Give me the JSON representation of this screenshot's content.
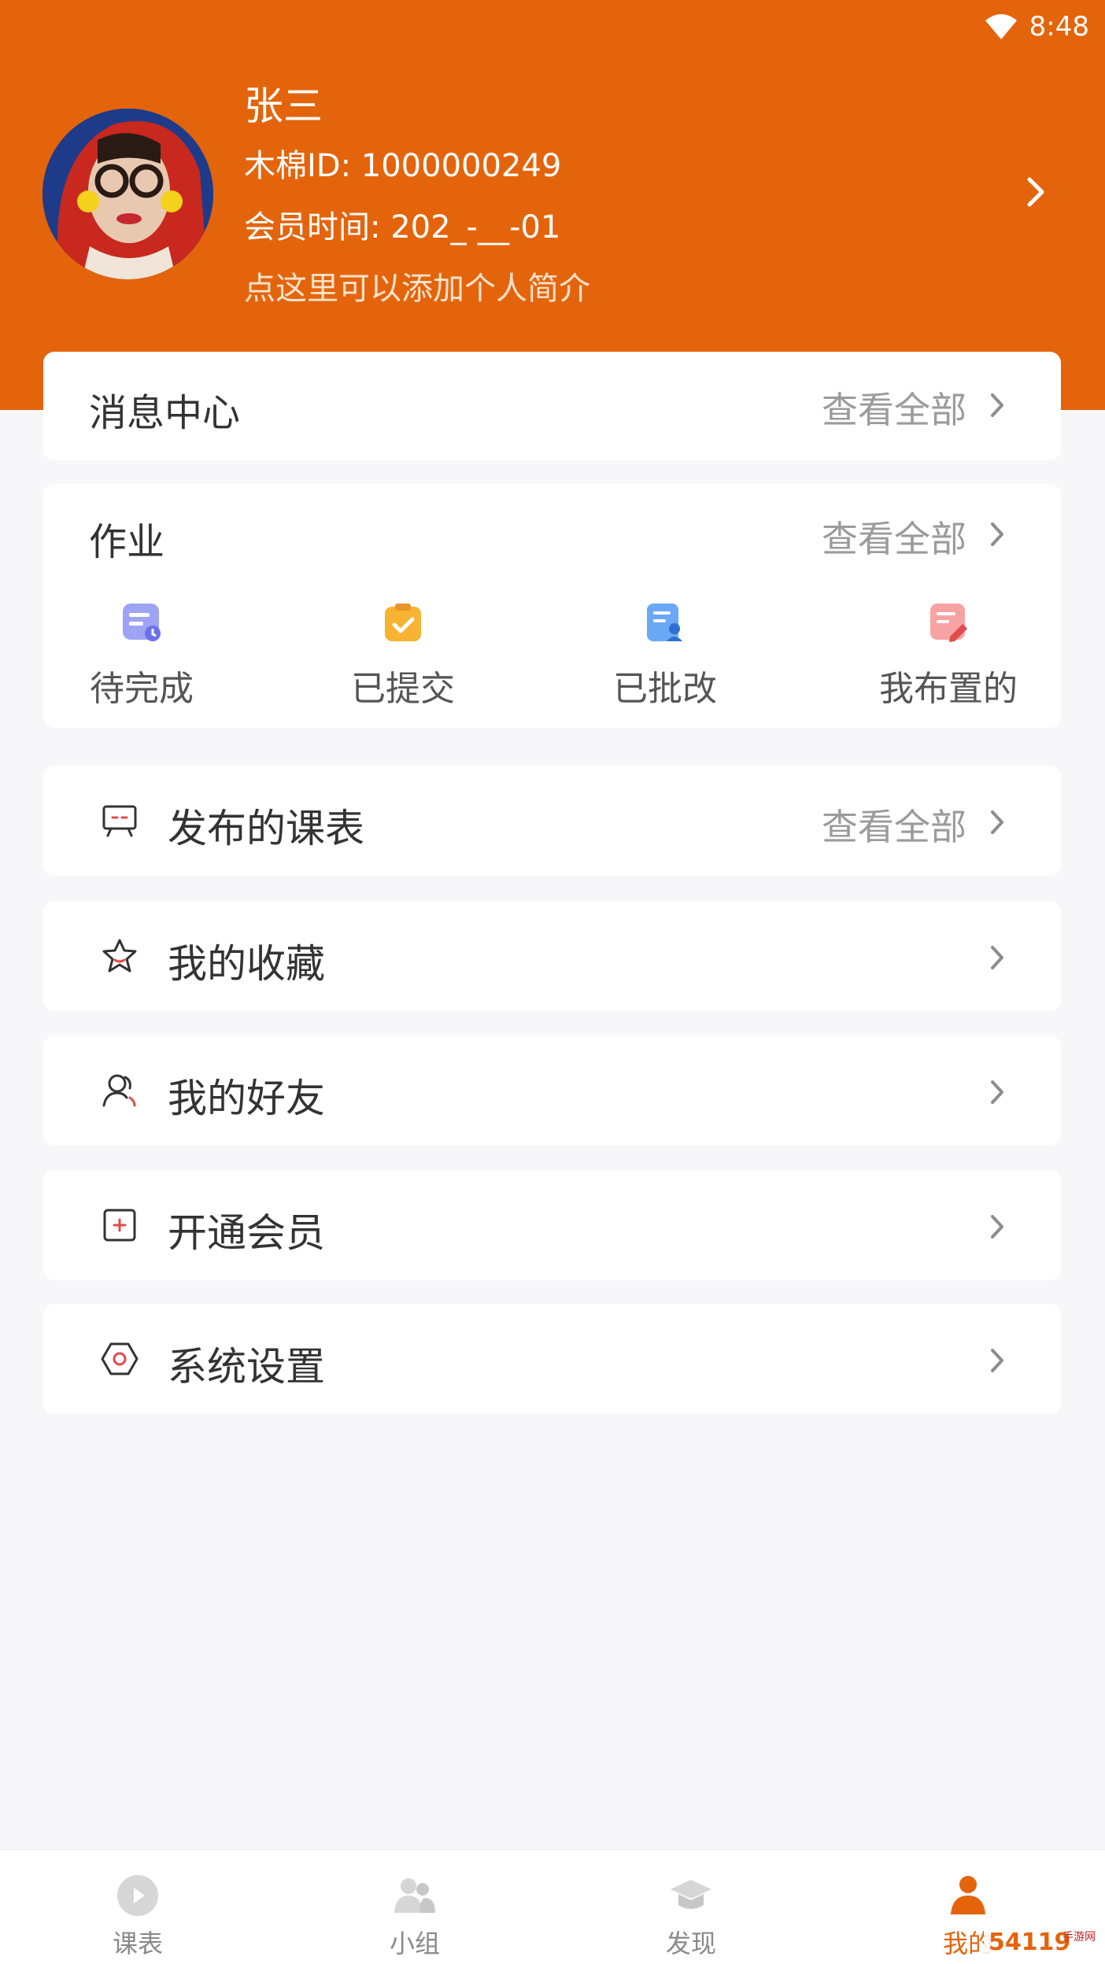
{
  "status_bar": {
    "time": "8:48"
  },
  "profile": {
    "name": "张三",
    "id_line": "木棉ID: 1000000249",
    "member_line": "会员时间: 202_-__-01",
    "intro_hint": "点这里可以添加个人简介"
  },
  "messages": {
    "title": "消息中心",
    "view_all": "查看全部"
  },
  "homework": {
    "title": "作业",
    "view_all": "查看全部",
    "items": [
      {
        "label": "待完成",
        "icon": "pending-homework-icon",
        "color": "#7b7ff0"
      },
      {
        "label": "已提交",
        "icon": "submitted-homework-icon",
        "color": "#f7b332"
      },
      {
        "label": "已批改",
        "icon": "graded-homework-icon",
        "color": "#4a90f2"
      },
      {
        "label": "我布置的",
        "icon": "assigned-homework-icon",
        "color": "#f26a6a"
      }
    ]
  },
  "menu": {
    "schedule": {
      "label": "发布的课表",
      "view_all": "查看全部",
      "icon": "schedule-board-icon"
    },
    "favorites": {
      "label": "我的收藏",
      "icon": "star-icon"
    },
    "friends": {
      "label": "我的好友",
      "icon": "friends-icon"
    },
    "membership": {
      "label": "开通会员",
      "icon": "plus-square-icon"
    },
    "settings": {
      "label": "系统设置",
      "icon": "settings-hexagon-icon"
    }
  },
  "tabbar": {
    "tabs": [
      {
        "label": "课表",
        "icon": "play-circle-icon",
        "active": false
      },
      {
        "label": "小组",
        "icon": "group-icon",
        "active": false
      },
      {
        "label": "发现",
        "icon": "graduation-cap-icon",
        "active": false
      },
      {
        "label": "我的",
        "icon": "person-icon",
        "active": true
      }
    ]
  },
  "watermark": {
    "text": "54119手游网"
  },
  "colors": {
    "brand": "#e4640c",
    "background": "#f7f7f9",
    "muted_text": "#9b9b9b"
  }
}
